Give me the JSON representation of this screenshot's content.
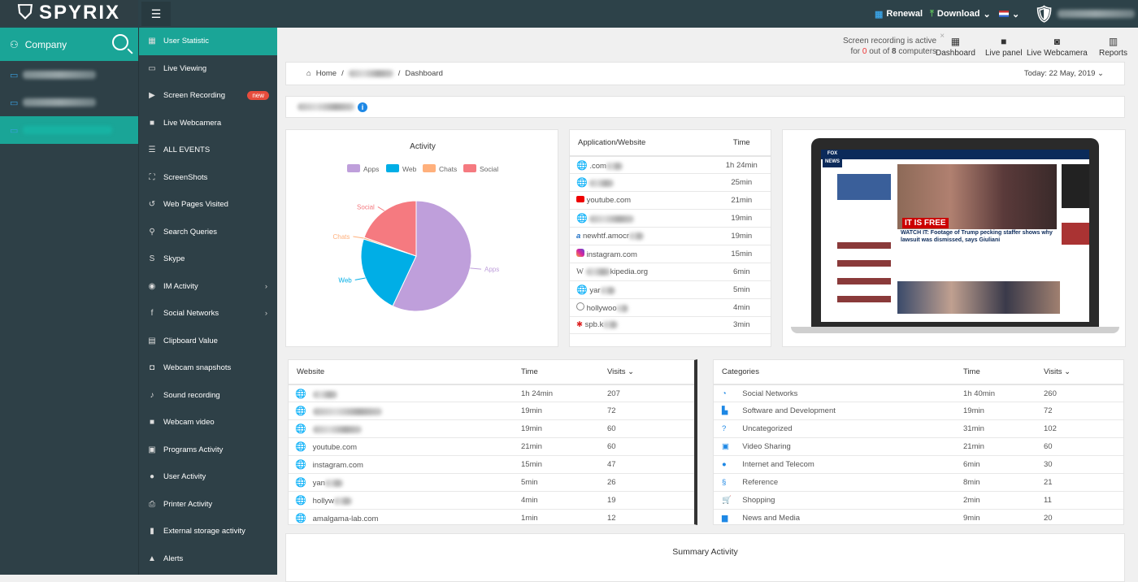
{
  "brand": "SPYRIX",
  "topbar": {
    "renewal": "Renewal",
    "download": "Download",
    "flag": "us-flag-icon",
    "chev": "⌄"
  },
  "sidebar": {
    "company": "Company",
    "computers": 3
  },
  "menu": [
    {
      "label": "User Statistic",
      "icon": "▦",
      "active": true
    },
    {
      "label": "Live Viewing",
      "icon": "▭"
    },
    {
      "label": "Screen Recording",
      "icon": "▶",
      "badge": "new"
    },
    {
      "label": "Live Webcamera",
      "icon": "■"
    },
    {
      "label": "ALL EVENTS",
      "icon": "☰"
    },
    {
      "label": "ScreenShots",
      "icon": "⛶"
    },
    {
      "label": "Web Pages Visited",
      "icon": "↺"
    },
    {
      "label": "Search Queries",
      "icon": "⚲"
    },
    {
      "label": "Skype",
      "icon": "S"
    },
    {
      "label": "IM Activity",
      "icon": "◉",
      "chevron": true
    },
    {
      "label": "Social Networks",
      "icon": "f",
      "chevron": true
    },
    {
      "label": "Clipboard Value",
      "icon": "▤"
    },
    {
      "label": "Webcam snapshots",
      "icon": "◘"
    },
    {
      "label": "Sound recording",
      "icon": "♪"
    },
    {
      "label": "Webcam video",
      "icon": "■"
    },
    {
      "label": "Programs Activity",
      "icon": "▣"
    },
    {
      "label": "User Activity",
      "icon": "●"
    },
    {
      "label": "Printer Activity",
      "icon": "⎙"
    },
    {
      "label": "External storage activity",
      "icon": "▮"
    },
    {
      "label": "Alerts",
      "icon": "▲"
    }
  ],
  "recording": {
    "line1": "Screen recording is active",
    "pre": "for ",
    "active": "0",
    "mid": " out of ",
    "total": "8",
    "post": " computers"
  },
  "quick": [
    {
      "label": "Dashboard",
      "icon": "▦"
    },
    {
      "label": "Live panel",
      "icon": "■"
    },
    {
      "label": "Live Webcamera",
      "icon": "◙"
    },
    {
      "label": "Reports",
      "icon": "▥"
    }
  ],
  "breadcrumb": {
    "home": "Home",
    "sep": "/",
    "current": "Dashboard",
    "date": "Today: 22 May, 2019"
  },
  "chart_data": {
    "type": "pie",
    "title": "Activity",
    "categories": [
      "Apps",
      "Web",
      "Chats",
      "Social"
    ],
    "values": [
      57,
      23,
      0.5,
      19.5
    ],
    "colors": [
      "#bf9fdb",
      "#00aee6",
      "#ffb07c",
      "#f57a80"
    ],
    "legend": "top"
  },
  "apps": {
    "headers": [
      "Application/Website",
      "Time"
    ],
    "rows": [
      {
        "icon": "globe",
        "name": ".com",
        "time": "1h 24min",
        "blur": 20
      },
      {
        "icon": "globe",
        "name": "",
        "time": "25min",
        "blur": 30
      },
      {
        "icon": "youtube",
        "name": "youtube.com",
        "time": "21min",
        "blur": 0
      },
      {
        "icon": "globe",
        "name": "",
        "time": "19min",
        "blur": 55
      },
      {
        "icon": "a",
        "name": "newhtf.amocr",
        "time": "19min",
        "blur": 18
      },
      {
        "icon": "instagram",
        "name": "instagram.com",
        "time": "15min",
        "blur": 0
      },
      {
        "icon": "W",
        "name": "kipedia.org",
        "time": "6min",
        "blur": 30,
        "pre": true
      },
      {
        "icon": "globe",
        "name": "yar",
        "time": "5min",
        "blur": 18
      },
      {
        "icon": "hollow",
        "name": "hollywoo",
        "time": "4min",
        "blur": 14
      },
      {
        "icon": "red",
        "name": "spb.k",
        "time": "3min",
        "blur": 18
      }
    ]
  },
  "screen": {
    "headline1": "IT IS FREE",
    "headline2": "WATCH IT: Footage of Trump pecking staffer shows why lawsuit was dismissed, says Giuliani",
    "logo": "FOX NEWS"
  },
  "websites": {
    "headers": [
      "Website",
      "Time",
      "Visits"
    ],
    "rows": [
      {
        "name": "",
        "time": "1h 24min",
        "visits": "207",
        "blur": 30
      },
      {
        "name": "",
        "time": "19min",
        "visits": "72",
        "blur": 85
      },
      {
        "name": "",
        "time": "19min",
        "visits": "60",
        "blur": 60
      },
      {
        "name": "youtube.com",
        "time": "21min",
        "visits": "60",
        "blur": 0
      },
      {
        "name": "instagram.com",
        "time": "15min",
        "visits": "47",
        "blur": 0
      },
      {
        "name": "yan",
        "time": "5min",
        "visits": "26",
        "blur": 22
      },
      {
        "name": "hollyw",
        "time": "4min",
        "visits": "19",
        "blur": 22
      },
      {
        "name": "amalgama-lab.com",
        "time": "1min",
        "visits": "12",
        "blur": 0
      }
    ]
  },
  "categories": {
    "headers": [
      "Categories",
      "Time",
      "Visits"
    ],
    "rows": [
      {
        "icon": "◔",
        "name": "Social Networks",
        "time": "1h 40min",
        "visits": "260"
      },
      {
        "icon": "▙",
        "name": "Software and Development",
        "time": "19min",
        "visits": "72"
      },
      {
        "icon": "?",
        "name": "Uncategorized",
        "time": "31min",
        "visits": "102"
      },
      {
        "icon": "▣",
        "name": "Video Sharing",
        "time": "21min",
        "visits": "60"
      },
      {
        "icon": "●",
        "name": "Internet and Telecom",
        "time": "6min",
        "visits": "30"
      },
      {
        "icon": "§",
        "name": "Reference",
        "time": "8min",
        "visits": "21"
      },
      {
        "icon": "🛒",
        "name": "Shopping",
        "time": "2min",
        "visits": "11"
      },
      {
        "icon": "▆",
        "name": "News and Media",
        "time": "9min",
        "visits": "20"
      }
    ]
  },
  "summary": {
    "title": "Summary Activity"
  }
}
